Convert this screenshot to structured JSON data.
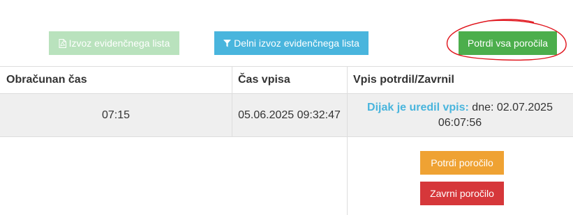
{
  "toolbar": {
    "export_label": "Izvoz evidenčnega lista",
    "export_icon": "file-pdf-icon",
    "partial_export_label": "Delni izvoz evidenčnega lista",
    "partial_export_icon": "filter-icon",
    "confirm_all_label": "Potrdi vsa poročila"
  },
  "table": {
    "headers": [
      "Obračunan čas",
      "Čas vpisa",
      "Vpis potrdil/Zavrnil"
    ],
    "rows": [
      {
        "billed_time": "07:15",
        "entry_time": "05.06.2025 09:32:47",
        "edited_label": "Dijak je uredil vpis:",
        "edited_value": "dne: 02.07.2025 06:07:56"
      }
    ]
  },
  "actions": {
    "confirm_label": "Potrdi poročilo",
    "reject_label": "Zavrni poročilo"
  },
  "colors": {
    "export_disabled": "#b9e2bd",
    "info": "#49b5dd",
    "success": "#4cae4c",
    "warning": "#efa233",
    "danger": "#d6373a",
    "annotation": "#e0151d"
  }
}
